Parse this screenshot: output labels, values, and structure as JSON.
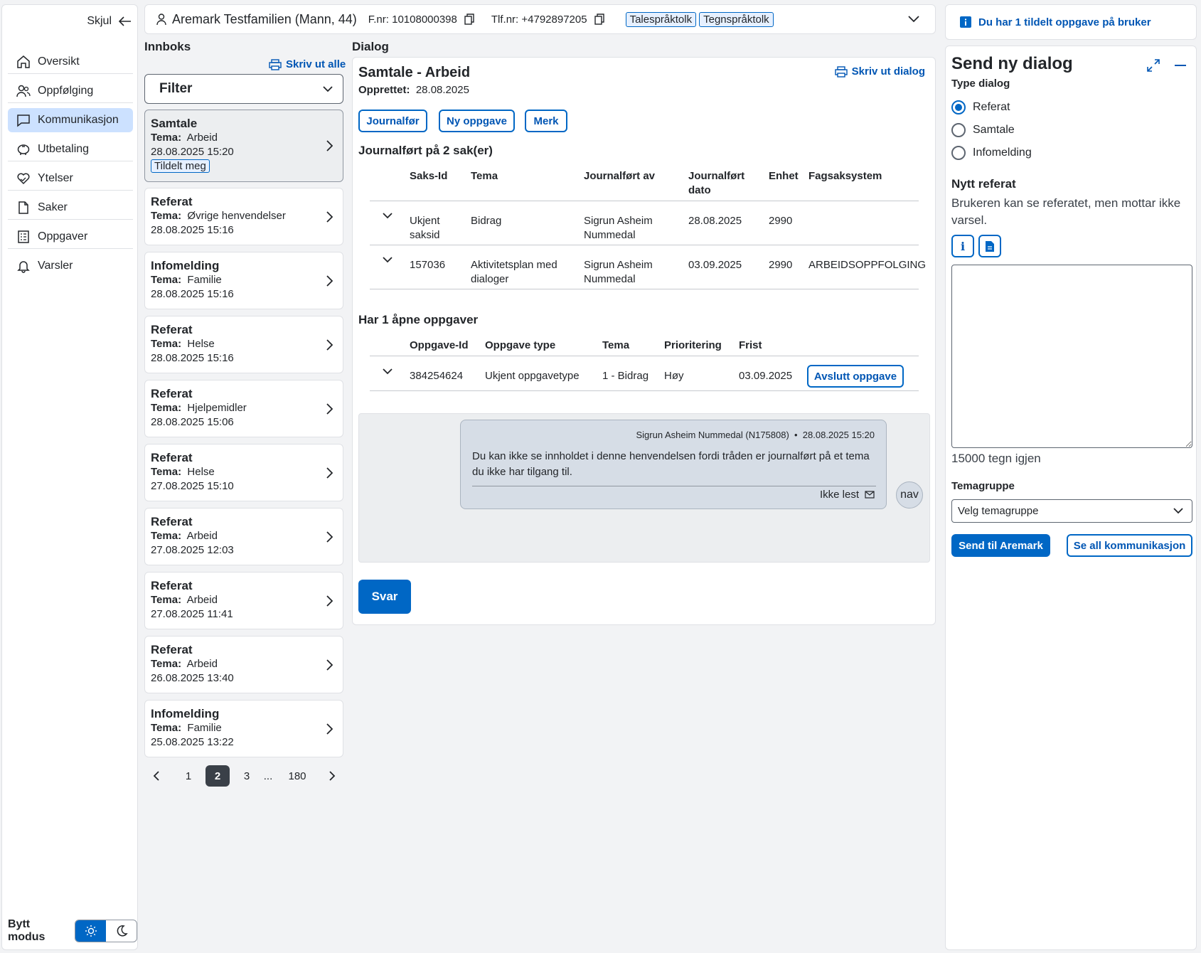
{
  "nav": {
    "hide_label": "Skjul",
    "items": [
      {
        "label": "Oversikt",
        "icon": "house-icon"
      },
      {
        "label": "Oppfølging",
        "icon": "people-icon"
      },
      {
        "label": "Kommunikasjon",
        "icon": "chat-icon",
        "active": true
      },
      {
        "label": "Utbetaling",
        "icon": "piggybank-icon"
      },
      {
        "label": "Ytelser",
        "icon": "hand-heart-icon"
      },
      {
        "label": "Saker",
        "icon": "file-icon"
      },
      {
        "label": "Oppgaver",
        "icon": "tasklist-icon"
      },
      {
        "label": "Varsler",
        "icon": "bell-icon"
      }
    ],
    "mode_label": "Bytt modus"
  },
  "header": {
    "person": "Aremark Testfamilien (Mann, 44)",
    "fnr": "F.nr: 10108000398",
    "tlf": "Tlf.nr: +4792897205",
    "tags": [
      "Talespråktolk",
      "Tegnspråktolk"
    ]
  },
  "inbox": {
    "title": "Innboks",
    "print_all": "Skriv ut alle",
    "filter": "Filter",
    "tema_label": "Tema:",
    "assigned_label": "Tildelt meg",
    "messages": [
      {
        "type": "Samtale",
        "tema": "Arbeid",
        "date": "28.08.2025 15:20"
      },
      {
        "type": "Referat",
        "tema": "Øvrige henvendelser",
        "date": "28.08.2025 15:16"
      },
      {
        "type": "Infomelding",
        "tema": "Familie",
        "date": "28.08.2025 15:16"
      },
      {
        "type": "Referat",
        "tema": "Helse",
        "date": "28.08.2025 15:16"
      },
      {
        "type": "Referat",
        "tema": "Hjelpemidler",
        "date": "28.08.2025 15:06"
      },
      {
        "type": "Referat",
        "tema": "Helse",
        "date": "27.08.2025 15:10"
      },
      {
        "type": "Referat",
        "tema": "Arbeid",
        "date": "27.08.2025 12:03"
      },
      {
        "type": "Referat",
        "tema": "Arbeid",
        "date": "27.08.2025 11:41"
      },
      {
        "type": "Referat",
        "tema": "Arbeid",
        "date": "26.08.2025 13:40"
      },
      {
        "type": "Infomelding",
        "tema": "Familie",
        "date": "25.08.2025 13:22"
      }
    ],
    "pagination": {
      "pages": [
        "1",
        "2",
        "3",
        "...",
        "180"
      ],
      "current": "2"
    }
  },
  "dialog": {
    "title": "Dialog",
    "heading": "Samtale - Arbeid",
    "print": "Skriv ut dialog",
    "created_label": "Opprettet:",
    "created": "28.08.2025",
    "buttons": [
      "Journalfør",
      "Ny oppgave",
      "Merk"
    ],
    "journal_title": "Journalført på 2 sak(er)",
    "journal_headers": [
      "Saks-Id",
      "Tema",
      "Journalført av",
      "Journalført dato",
      "Enhet",
      "Fagsaksystem"
    ],
    "journal_rows": [
      [
        "Ukjent saksid",
        "Bidrag",
        "Sigrun Asheim Nummedal",
        "28.08.2025",
        "2990",
        ""
      ],
      [
        "157036",
        "Aktivitetsplan med dialoger",
        "Sigrun Asheim Nummedal",
        "03.09.2025",
        "2990",
        "ARBEIDSOPPFOLGING"
      ]
    ],
    "tasks_title": "Har 1 åpne oppgaver",
    "task_headers": [
      "Oppgave-Id",
      "Oppgave type",
      "Tema",
      "Prioritering",
      "Frist"
    ],
    "task_rows": [
      [
        "384254624",
        "Ukjent oppgavetype",
        "1 - Bidrag",
        "Høy",
        "03.09.2025"
      ]
    ],
    "close_task": "Avslutt oppgave",
    "message_meta": "Sigrun Asheim Nummedal (N175808)  •  28.08.2025 15:20",
    "message_text": "Du kan ikke se innholdet i denne henvendelsen fordi tråden er journalført på et tema du ikke har tilgang til.",
    "message_status": "Ikke lest",
    "avatar": "nav",
    "reply": "Svar"
  },
  "notice": "Du har 1 tildelt oppgave på bruker",
  "send": {
    "title": "Send ny dialog",
    "type_label": "Type dialog",
    "options": [
      "Referat",
      "Samtale",
      "Infomelding"
    ],
    "selected": "Referat",
    "subtitle": "Nytt referat",
    "help": "Brukeren kan se referatet, men mottar ikke varsel.",
    "info_btn": "i",
    "counter": "15000 tegn igjen",
    "temagruppe_label": "Temagruppe",
    "temagruppe_placeholder": "Velg temagruppe",
    "send_btn": "Send til Aremark",
    "all_btn": "Se all kommunikasjon"
  },
  "colors": {
    "accent": "#0067c5",
    "selected_nav": "#cce1ff"
  }
}
